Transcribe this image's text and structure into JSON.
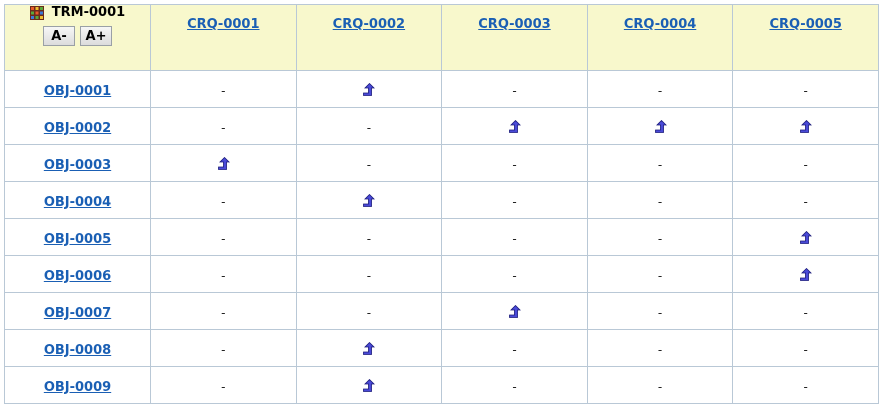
{
  "matrix": {
    "title": "TRM-0001",
    "font_decrease_label": "A-",
    "font_increase_label": "A+",
    "empty_cell": "-",
    "columns": [
      "CRQ-0001",
      "CRQ-0002",
      "CRQ-0003",
      "CRQ-0004",
      "CRQ-0005"
    ],
    "rows": [
      {
        "id": "OBJ-0001",
        "cells": [
          "-",
          "trace",
          "-",
          "-",
          "-"
        ]
      },
      {
        "id": "OBJ-0002",
        "cells": [
          "-",
          "-",
          "trace",
          "trace",
          "trace"
        ]
      },
      {
        "id": "OBJ-0003",
        "cells": [
          "trace",
          "-",
          "-",
          "-",
          "-"
        ]
      },
      {
        "id": "OBJ-0004",
        "cells": [
          "-",
          "trace",
          "-",
          "-",
          "-"
        ]
      },
      {
        "id": "OBJ-0005",
        "cells": [
          "-",
          "-",
          "-",
          "-",
          "trace"
        ]
      },
      {
        "id": "OBJ-0006",
        "cells": [
          "-",
          "-",
          "-",
          "-",
          "trace"
        ]
      },
      {
        "id": "OBJ-0007",
        "cells": [
          "-",
          "-",
          "trace",
          "-",
          "-"
        ]
      },
      {
        "id": "OBJ-0008",
        "cells": [
          "-",
          "trace",
          "-",
          "-",
          "-"
        ]
      },
      {
        "id": "OBJ-0009",
        "cells": [
          "-",
          "trace",
          "-",
          "-",
          "-"
        ]
      }
    ]
  },
  "icons": {
    "corner": "grid-matrix-icon",
    "trace": "trace-arrow-icon"
  },
  "colors": {
    "header_bg": "#f8f8cc",
    "link": "#1a5fb4",
    "border": "#b9c8d6",
    "trace_arrow": "#4a4ad8"
  }
}
